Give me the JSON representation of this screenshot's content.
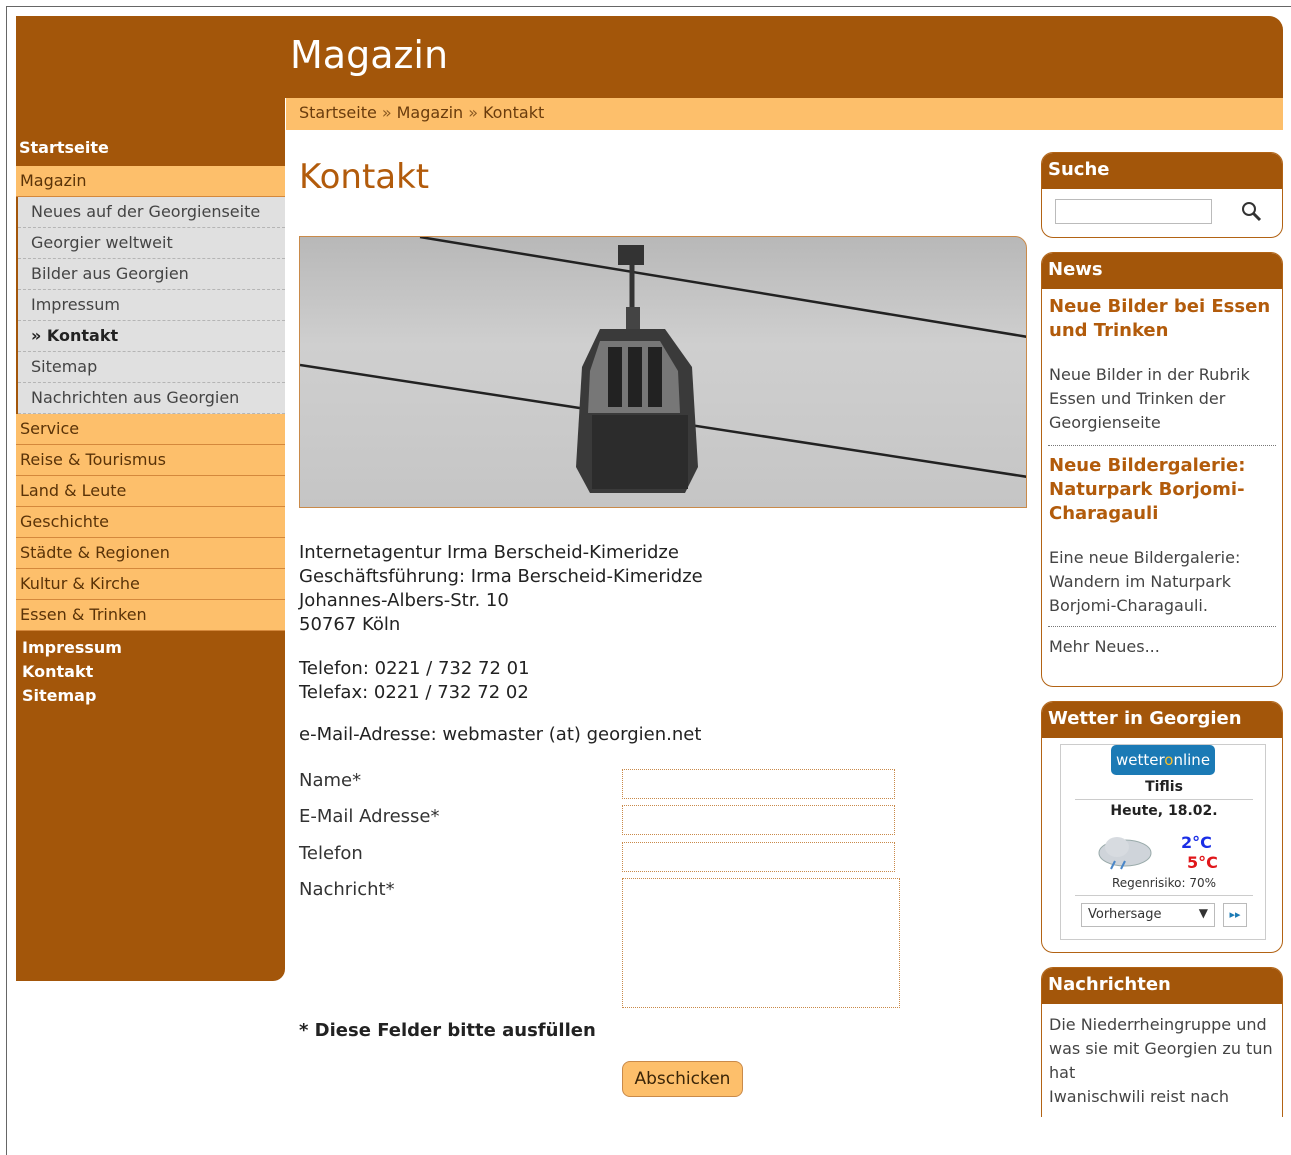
{
  "header": {
    "title": "Magazin"
  },
  "breadcrumb": [
    "Startseite",
    "Magazin",
    "Kontakt"
  ],
  "breadcrumb_sep": "»",
  "sidebar": {
    "top": "Startseite",
    "section": "Magazin",
    "sub_items": [
      {
        "label": "Neues auf der Georgienseite"
      },
      {
        "label": "Georgier weltweit"
      },
      {
        "label": "Bilder aus Georgien"
      },
      {
        "label": "Impressum"
      },
      {
        "label": "» Kontakt"
      },
      {
        "label": "Sitemap"
      },
      {
        "label": "Nachrichten aus Georgien"
      }
    ],
    "items": [
      {
        "label": "Service"
      },
      {
        "label": "Reise & Tourismus"
      },
      {
        "label": "Land & Leute"
      },
      {
        "label": "Geschichte"
      },
      {
        "label": "Städte & Regionen"
      },
      {
        "label": "Kultur & Kirche"
      },
      {
        "label": "Essen & Trinken"
      }
    ],
    "footer": [
      "Impressum",
      "Kontakt",
      "Sitemap"
    ]
  },
  "main": {
    "title": "Kontakt",
    "address": [
      "Internetagentur Irma Berscheid-Kimeridze",
      "Geschäftsführung: Irma Berscheid-Kimeridze",
      "Johannes-Albers-Str. 10",
      "50767 Köln"
    ],
    "phone": [
      "Telefon: 0221 / 732 72 01",
      "Telefax: 0221 / 732 72 02"
    ],
    "email": "e-Mail-Adresse: webmaster (at) georgien.net",
    "form": {
      "name_label": "Name*",
      "email_label": "E-Mail Adresse*",
      "phone_label": "Telefon",
      "message_label": "Nachricht*",
      "required_note": "* Diese Felder bitte ausfüllen",
      "submit_label": "Abschicken"
    }
  },
  "search": {
    "title": "Suche"
  },
  "news": {
    "title": "News",
    "items": [
      {
        "title": "Neue Bilder bei Essen und Trinken",
        "text": "Neue Bilder in der Rubrik Essen und Trinken der Georgienseite"
      },
      {
        "title": "Neue Bildergalerie: Naturpark Borjomi-Charagauli",
        "text": "Eine neue Bildergalerie: Wandern im Naturpark Borjomi-Charagauli."
      }
    ],
    "more": "Mehr Neues..."
  },
  "weather": {
    "title": "Wetter in Georgien",
    "brand_a": "wetter",
    "brand_b": "o",
    "brand_c": "nline",
    "city": "Tiflis",
    "date": "Heute, 18.02.",
    "low": "2°C",
    "high": "5°C",
    "rain": "Regenrisiko: 70%",
    "select": "Vorhersage",
    "colors": {
      "low": "#1a2ee6",
      "high": "#e0161a",
      "brand": "#1b7ab5"
    }
  },
  "nachrichten": {
    "title": "Nachrichten",
    "items": [
      "Die Niederrheingruppe und was sie mit Georgien zu tun hat",
      "Iwanischwili reist nach"
    ]
  }
}
